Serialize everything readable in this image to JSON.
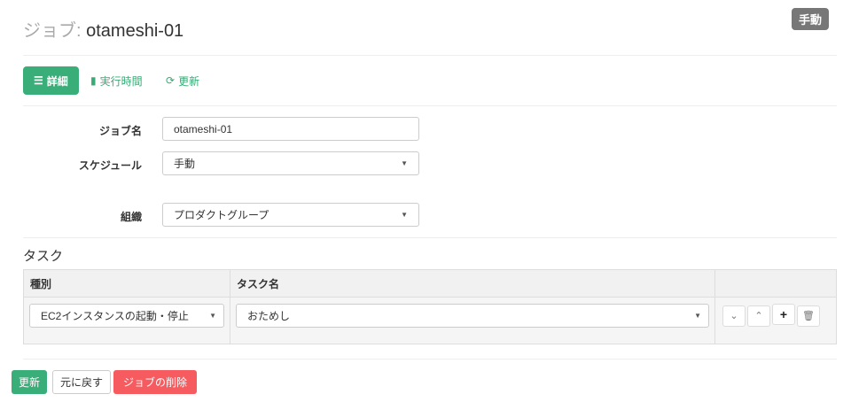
{
  "header": {
    "title_prefix": "ジョブ:",
    "title_name": "otameshi-01",
    "mode_badge": "手動"
  },
  "tabs": [
    {
      "label": "詳細",
      "icon": "list-icon"
    },
    {
      "label": "実行時間",
      "icon": "bar-chart-icon"
    },
    {
      "label": "更新",
      "icon": "refresh-icon"
    }
  ],
  "form": {
    "job_name_label": "ジョブ名",
    "job_name_value": "otameshi-01",
    "schedule_label": "スケジュール",
    "schedule_value": "手動",
    "org_label": "組織",
    "org_value": "プロダクトグループ"
  },
  "tasks": {
    "title": "タスク",
    "headers": [
      "種別",
      "タスク名",
      ""
    ],
    "rows": [
      {
        "type": "EC2インスタンスの起動・停止",
        "name": "おためし"
      }
    ]
  },
  "actions": {
    "update": "更新",
    "revert": "元に戻す",
    "delete": "ジョブの削除"
  },
  "colors": {
    "accent": "#3aae78",
    "danger": "#f65b5f",
    "badge": "#777777"
  }
}
